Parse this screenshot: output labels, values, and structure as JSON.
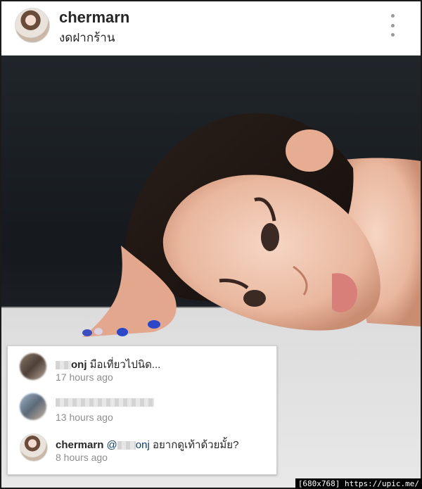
{
  "header": {
    "username": "chermarn",
    "location": "งดฝากร้าน",
    "more_icon": "more-vertical-icon"
  },
  "photo": {
    "subject": "post-photo"
  },
  "comments": [
    {
      "user": "",
      "user_suffix": "onj",
      "text": " มือเที่ยวไปนิด...",
      "time": "17 hours ago",
      "avatar": "blurred"
    },
    {
      "user": "",
      "text": "",
      "time": "13 hours ago",
      "avatar": "blurred"
    },
    {
      "user": "chermarn",
      "mention": "@",
      "mention_suffix": "onj",
      "text": " อยากดูเท้าด้วยมั้ย?",
      "time": "8 hours ago",
      "avatar": "profile"
    }
  ],
  "watermark": "[680x768] https://upic.me/"
}
